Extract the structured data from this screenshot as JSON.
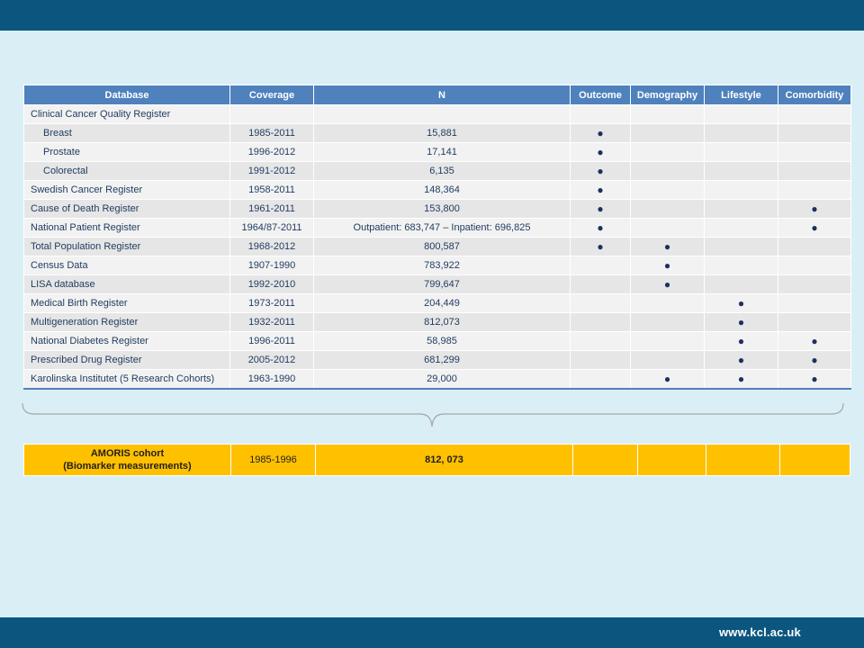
{
  "footer": {
    "url": "www.kcl.ac.uk"
  },
  "table": {
    "headers": [
      "Database",
      "Coverage",
      "N",
      "Outcome",
      "Demography",
      "Lifestyle",
      "Comorbidity"
    ],
    "rows": [
      {
        "name": "Clinical Cancer Quality Register",
        "coverage": "",
        "n": "",
        "outcome": "",
        "demography": "",
        "lifestyle": "",
        "comorbidity": ""
      },
      {
        "name": "Breast",
        "coverage": "1985-2011",
        "n": "15,881",
        "outcome": "●",
        "demography": "",
        "lifestyle": "",
        "comorbidity": ""
      },
      {
        "name": "Prostate",
        "coverage": "1996-2012",
        "n": "17,141",
        "outcome": "●",
        "demography": "",
        "lifestyle": "",
        "comorbidity": ""
      },
      {
        "name": "Colorectal",
        "coverage": "1991-2012",
        "n": "6,135",
        "outcome": "●",
        "demography": "",
        "lifestyle": "",
        "comorbidity": ""
      },
      {
        "name": "Swedish Cancer Register",
        "coverage": "1958-2011",
        "n": "148,364",
        "outcome": "●",
        "demography": "",
        "lifestyle": "",
        "comorbidity": ""
      },
      {
        "name": "Cause of Death Register",
        "coverage": "1961-2011",
        "n": "153,800",
        "outcome": "●",
        "demography": "",
        "lifestyle": "",
        "comorbidity": "●"
      },
      {
        "name": "National Patient Register",
        "coverage": "1964/87-2011",
        "n": "Outpatient: 683,747 – Inpatient: 696,825",
        "outcome": "●",
        "demography": "",
        "lifestyle": "",
        "comorbidity": "●"
      },
      {
        "name": "Total Population Register",
        "coverage": "1968-2012",
        "n": "800,587",
        "outcome": "●",
        "demography": "●",
        "lifestyle": "",
        "comorbidity": ""
      },
      {
        "name": "Census Data",
        "coverage": "1907-1990",
        "n": "783,922",
        "outcome": "",
        "demography": "●",
        "lifestyle": "",
        "comorbidity": ""
      },
      {
        "name": "LISA database",
        "coverage": "1992-2010",
        "n": "799,647",
        "outcome": "",
        "demography": "●",
        "lifestyle": "",
        "comorbidity": ""
      },
      {
        "name": "Medical Birth Register",
        "coverage": "1973-2011",
        "n": "204,449",
        "outcome": "",
        "demography": "",
        "lifestyle": "●",
        "comorbidity": ""
      },
      {
        "name": "Multigeneration Register",
        "coverage": "1932-2011",
        "n": "812,073",
        "outcome": "",
        "demography": "",
        "lifestyle": "●",
        "comorbidity": ""
      },
      {
        "name": "National Diabetes Register",
        "coverage": "1996-2011",
        "n": "58,985",
        "outcome": "",
        "demography": "",
        "lifestyle": "●",
        "comorbidity": "●"
      },
      {
        "name": "Prescribed Drug Register",
        "coverage": "2005-2012",
        "n": "681,299",
        "outcome": "",
        "demography": "",
        "lifestyle": "●",
        "comorbidity": "●"
      },
      {
        "name": "Karolinska Institutet (5 Research Cohorts)",
        "coverage": "1963-1990",
        "n": "29,000",
        "outcome": "",
        "demography": "●",
        "lifestyle": "●",
        "comorbidity": "●"
      }
    ]
  },
  "amoris": {
    "name_line1": "AMORIS cohort",
    "name_line2": "(Biomarker measurements)",
    "coverage": "1985-1996",
    "n": "812, 073"
  }
}
